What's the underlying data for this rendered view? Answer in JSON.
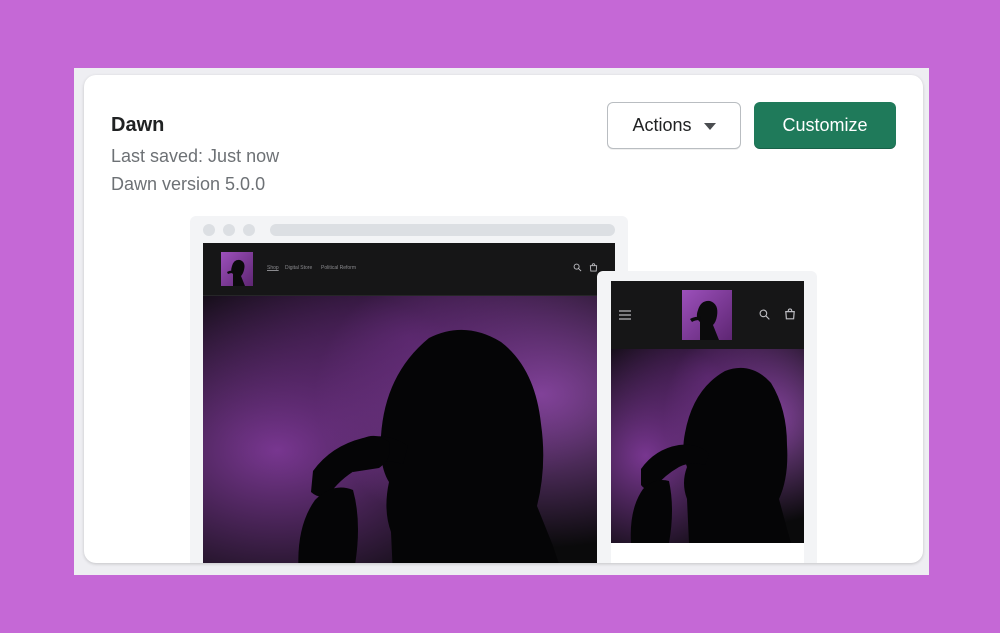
{
  "theme": {
    "name": "Dawn",
    "last_saved": "Last saved: Just now",
    "version": "Dawn version 5.0.0"
  },
  "buttons": {
    "actions_label": "Actions",
    "customize_label": "Customize"
  },
  "desktop_preview": {
    "nav": [
      "Shop",
      "Digital Store",
      "Political Reform"
    ]
  },
  "colors": {
    "page_background": "#c568d6",
    "primary_button": "#1f7a5a",
    "hero_purple": "#8c3fa8"
  },
  "icons": {
    "actions_caret": "caret-down-icon",
    "search": "search-icon",
    "cart": "cart-icon",
    "menu": "hamburger-menu-icon"
  }
}
